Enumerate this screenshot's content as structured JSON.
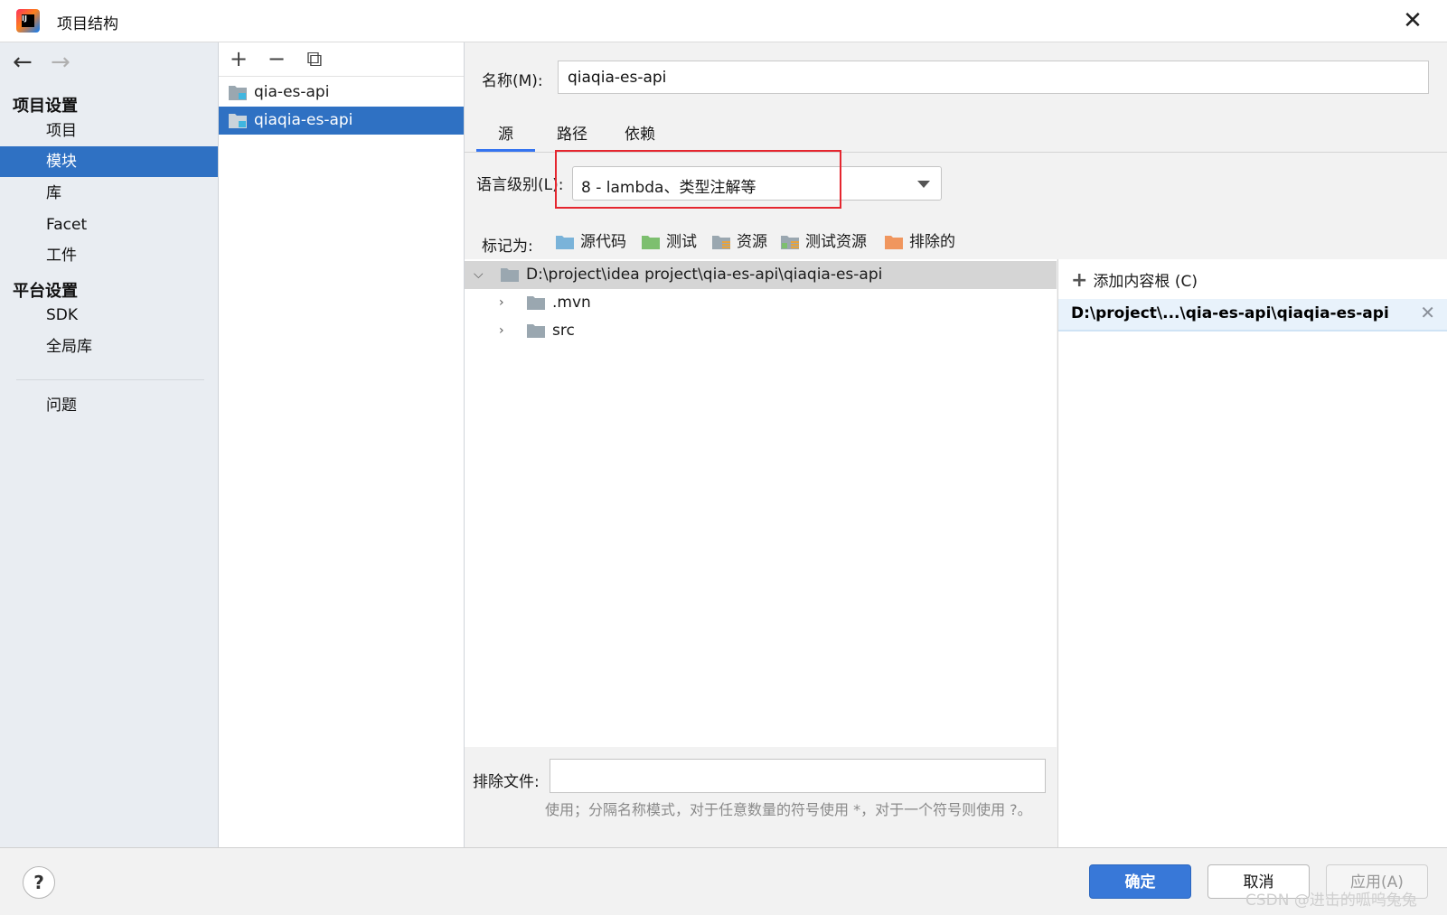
{
  "window": {
    "title": "项目结构",
    "logo_text": "IJ"
  },
  "sidebar": {
    "project_settings_title": "项目设置",
    "project_items": [
      "项目",
      "模块",
      "库",
      "Facet",
      "工件"
    ],
    "platform_settings_title": "平台设置",
    "platform_items": [
      "SDK",
      "全局库"
    ],
    "problems": "问题",
    "selected": "模块"
  },
  "modules": {
    "toolbar": {
      "add": "+",
      "remove": "−",
      "copy": "⧉"
    },
    "items": [
      "qia-es-api",
      "qiaqia-es-api"
    ],
    "selected": "qiaqia-es-api"
  },
  "main": {
    "name_label": "名称(M):",
    "name_value": "qiaqia-es-api",
    "tabs": [
      "源",
      "路径",
      "依赖"
    ],
    "active_tab": "源",
    "language_level_label": "语言级别(L):",
    "language_level_value": "8 - lambda、类型注解等",
    "mark_as_label": "标记为:",
    "mark_buttons": [
      {
        "label": "源代码",
        "color": "#7ab3d9"
      },
      {
        "label": "测试",
        "color": "#7dbf6f"
      },
      {
        "label": "资源",
        "color": "#9aa7b0"
      },
      {
        "label": "测试资源",
        "color": "#9aa7b0"
      },
      {
        "label": "排除的",
        "color": "#f0965e"
      }
    ],
    "tree": {
      "root": "D:\\project\\idea project\\qia-es-api\\qiaqia-es-api",
      "children": [
        ".mvn",
        "src"
      ]
    },
    "content_root": {
      "add_label": "添加内容根 (C)",
      "entry": "D:\\project\\...\\qia-es-api\\qiaqia-es-api"
    },
    "exclude_label": "排除文件:",
    "exclude_value": "",
    "exclude_hint": "使用；分隔名称模式，对于任意数量的符号使用 *，对于一个符号则使用 ?。"
  },
  "footer": {
    "help": "?",
    "ok": "确定",
    "cancel": "取消",
    "apply": "应用(A)"
  },
  "watermark": "CSDN @进击的呱呜兔兔"
}
